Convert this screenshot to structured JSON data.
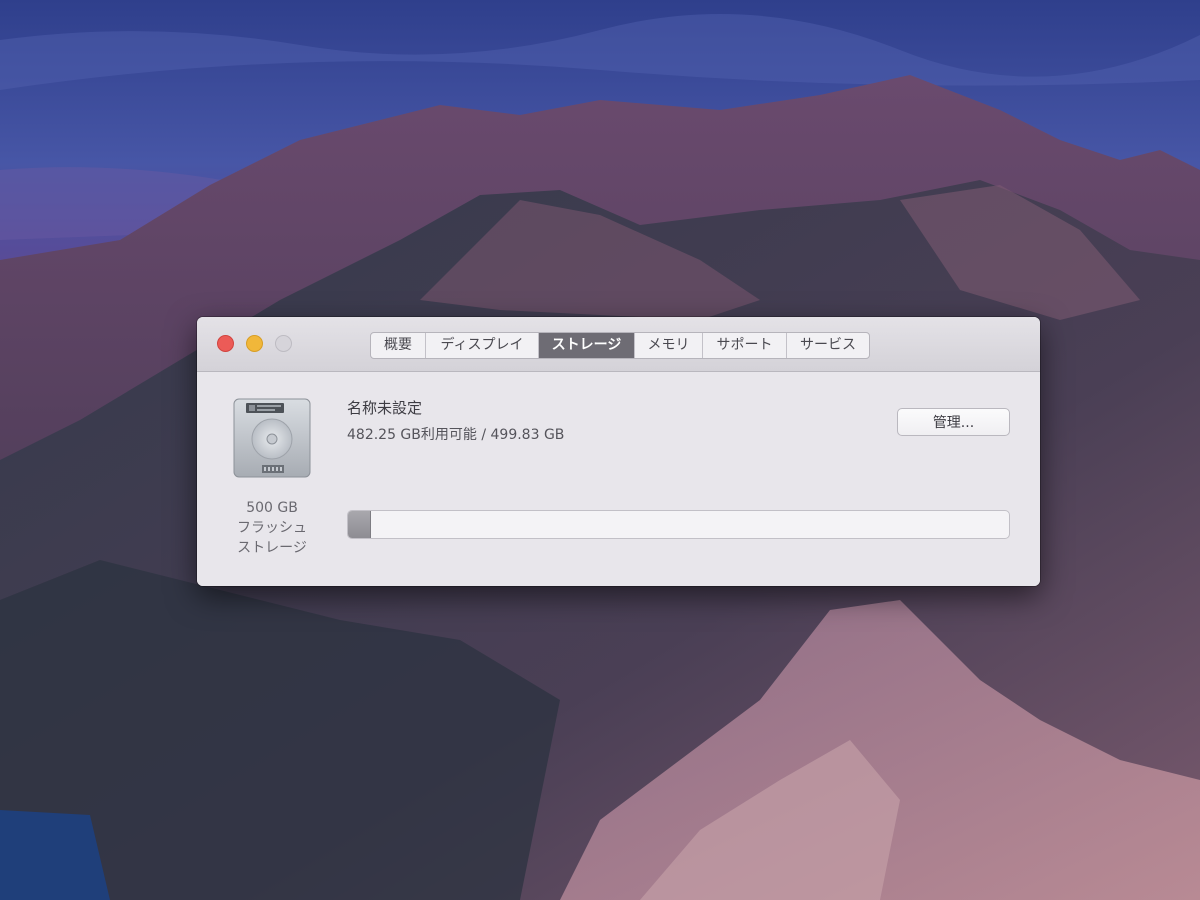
{
  "window": {
    "tabs": [
      {
        "label": "概要",
        "active": false
      },
      {
        "label": "ディスプレイ",
        "active": false
      },
      {
        "label": "ストレージ",
        "active": true
      },
      {
        "label": "メモリ",
        "active": false
      },
      {
        "label": "サポート",
        "active": false
      },
      {
        "label": "サービス",
        "active": false
      }
    ]
  },
  "storage": {
    "disk_icon": "hard-drive-icon",
    "capacity_line1": "500 GB",
    "capacity_line2": "フラッシュ",
    "capacity_line3": "ストレージ",
    "disk_name": "名称未設定",
    "available_text": "482.25 GB利用可能 / 499.83 GB",
    "manage_button_label": "管理...",
    "used_fraction": 0.035
  },
  "colors": {
    "close": "#ec5b57",
    "minimize": "#f1b73a",
    "zoom_disabled": "#d6d4da",
    "active_tab": "#6e6c74"
  }
}
